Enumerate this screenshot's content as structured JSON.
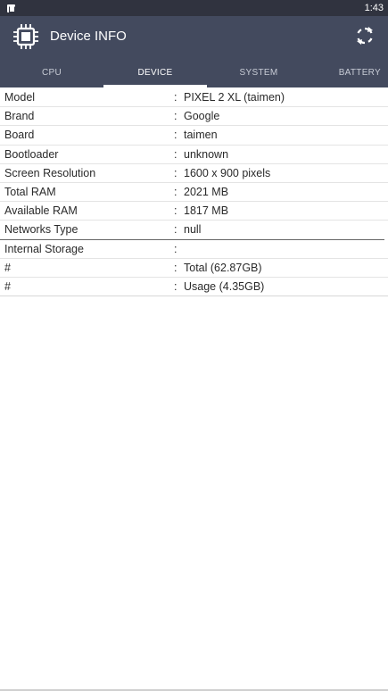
{
  "status": {
    "time": "1:43"
  },
  "app": {
    "title": "Device INFO"
  },
  "tabs": [
    {
      "label": "CPU",
      "active": false
    },
    {
      "label": "DEVICE",
      "active": true
    },
    {
      "label": "SYSTEM",
      "active": false
    },
    {
      "label": "BATTERY",
      "active": false
    }
  ],
  "rows": [
    {
      "label": "Model",
      "sep": ":",
      "value": "PIXEL 2 XL (taimen)"
    },
    {
      "label": "Brand",
      "sep": ":",
      "value": "Google"
    },
    {
      "label": "Board",
      "sep": ":",
      "value": "taimen"
    },
    {
      "label": "Bootloader",
      "sep": ":",
      "value": "unknown"
    },
    {
      "label": "Screen Resolution",
      "sep": ":",
      "value": "1600 x 900 pixels"
    },
    {
      "label": "Total RAM",
      "sep": ":",
      "value": "2021 MB"
    },
    {
      "label": "Available RAM",
      "sep": ":",
      "value": "1817 MB"
    },
    {
      "label": "Networks Type",
      "sep": ":",
      "value": "null"
    },
    {
      "label": "Internal Storage",
      "sep": ":",
      "value": ""
    },
    {
      "label": "#",
      "sep": ":",
      "value": "Total (62.87GB)"
    },
    {
      "label": "#",
      "sep": ":",
      "value": "Usage (4.35GB)"
    }
  ],
  "colors": {
    "status_bar": "#30333f",
    "app_bar": "#434a5e",
    "tab_indicator": "#ffffff"
  },
  "icons": {
    "app": "cpu-chip-icon",
    "refresh": "refresh-icon"
  }
}
